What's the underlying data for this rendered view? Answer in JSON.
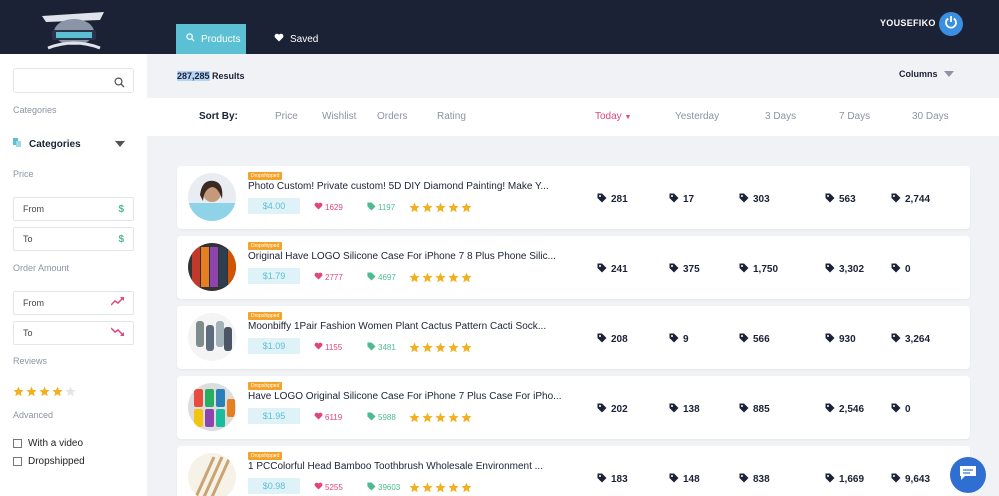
{
  "header": {
    "tabs": [
      {
        "label": "Products",
        "icon": "search-icon",
        "active": true
      },
      {
        "label": "Saved",
        "icon": "heart-icon",
        "active": false
      }
    ],
    "username": "YOUSEFIKO",
    "colors": {
      "bar": "#1b2235",
      "accent": "#5cc0d4"
    }
  },
  "sidebar": {
    "search_placeholder": "",
    "categories_label": "Categories",
    "categories_dropdown": "Categories",
    "price_label": "Price",
    "price_from": "From",
    "price_to": "To",
    "price_icon": "$",
    "order_amount_label": "Order Amount",
    "order_from": "From",
    "order_to": "To",
    "reviews_label": "Reviews",
    "reviews_stars": 4,
    "advanced_label": "Advanced",
    "with_video": "With a video",
    "dropshipped": "Dropshipped"
  },
  "results": {
    "count": "287,285",
    "suffix": " Results",
    "columns_label": "Columns"
  },
  "sort": {
    "label": "Sort By:",
    "options": [
      "Price",
      "Wishlist",
      "Orders",
      "Rating"
    ],
    "periods": [
      "Today",
      "Yesterday",
      "3 Days",
      "7 Days",
      "30 Days"
    ],
    "active_period": "Today"
  },
  "products": [
    {
      "badge": "Dropshipped",
      "title": "Photo Custom! Private custom! 5D DIY Diamond Painting! Make Y...",
      "price": "$4.00",
      "wishlist": "1629",
      "orders": "1197",
      "stars": 5,
      "metrics": [
        "281",
        "17",
        "303",
        "563",
        "2,744"
      ]
    },
    {
      "badge": "Dropshipped",
      "title": "Original Have LOGO Silicone Case For iPhone 7 8 Plus Phone Silic...",
      "price": "$1.79",
      "wishlist": "2777",
      "orders": "4697",
      "stars": 5,
      "metrics": [
        "241",
        "375",
        "1,750",
        "3,302",
        "0"
      ]
    },
    {
      "badge": "Dropshipped",
      "title": "Moonbiffy 1Pair Fashion Women Plant Cactus Pattern Cacti Sock...",
      "price": "$1.09",
      "wishlist": "1155",
      "orders": "3481",
      "stars": 5,
      "metrics": [
        "208",
        "9",
        "566",
        "930",
        "3,264"
      ]
    },
    {
      "badge": "Dropshipped",
      "title": "Have LOGO Original Silicone Case For iPhone 7 Plus Case For iPho...",
      "price": "$1.95",
      "wishlist": "6119",
      "orders": "5988",
      "stars": 5,
      "metrics": [
        "202",
        "138",
        "885",
        "2,546",
        "0"
      ]
    },
    {
      "badge": "Dropshipped",
      "title": "1 PCColorful Head Bamboo Toothbrush Wholesale Environment ...",
      "price": "$0.98",
      "wishlist": "5255",
      "orders": "39603",
      "stars": 5,
      "metrics": [
        "183",
        "148",
        "838",
        "1,669",
        "9,643"
      ]
    }
  ]
}
